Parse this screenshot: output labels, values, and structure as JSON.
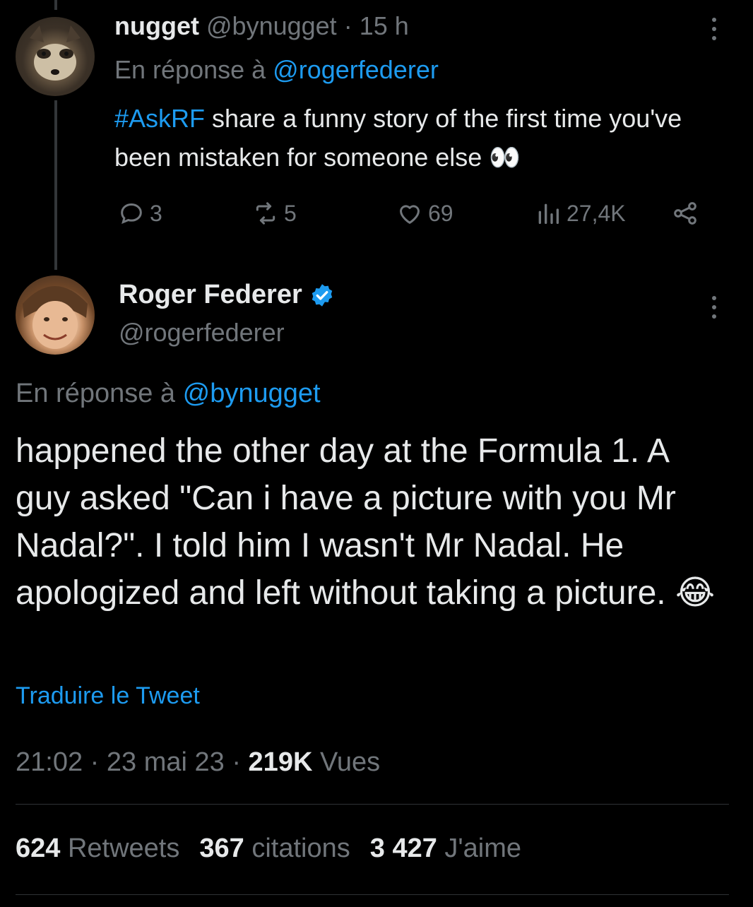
{
  "reply_tweet": {
    "display_name": "nugget",
    "handle": "@bynugget",
    "separator": "·",
    "time": "15 h",
    "reply_prefix": "En réponse à",
    "reply_to": "@rogerfederer",
    "hashtag": "#AskRF",
    "text": " share a funny story of the first time you've been mistaken for someone else 👀",
    "actions": {
      "replies": "3",
      "retweets": "5",
      "likes": "69",
      "views": "27,4K"
    },
    "icons": [
      "reply-icon",
      "retweet-icon",
      "like-icon",
      "views-icon",
      "share-icon",
      "more-icon"
    ]
  },
  "main_tweet": {
    "display_name": "Roger Federer",
    "handle": "@rogerfederer",
    "reply_prefix": "En réponse à",
    "reply_to": "@bynugget",
    "text": "happened the other day at the Formula 1. A guy asked \"Can i have a picture with you Mr Nadal?\". I told him I wasn't Mr Nadal. He apologized and left without taking a picture. 😂",
    "translate_label": "Traduire le Tweet",
    "time": "21:02",
    "date": "23 mai 23",
    "sep1": " · ",
    "sep2": " · ",
    "views_count": "219K",
    "views_label": " Vues",
    "stats": {
      "retweets_count": "624",
      "retweets_label": " Retweets",
      "quotes_count": "367",
      "quotes_label": " citations",
      "likes_count": "3 427",
      "likes_label": " J'aime"
    }
  },
  "colors": {
    "background": "#000000",
    "text": "#e7e9ea",
    "muted": "#71767b",
    "link": "#1d9bf0",
    "verified": "#1d9bf0"
  }
}
